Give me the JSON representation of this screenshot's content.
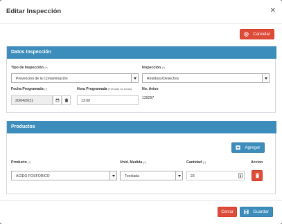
{
  "modal": {
    "title": "Editar Inspección",
    "close_icon": "close-icon"
  },
  "actions": {
    "cancel_top_label": "Cancelar"
  },
  "datos": {
    "header": "Datos Inspección",
    "tipo": {
      "label": "Tipo de Inspección",
      "hint": "(*)",
      "value": "Prevención de la Contaminación"
    },
    "inspeccion": {
      "label": "Inspección",
      "hint": "(*)",
      "value": "Residuos/Desechos"
    },
    "fecha": {
      "label": "Fecha Programada",
      "hint": "(*)",
      "value": "20/04/2021"
    },
    "hora": {
      "label": "Hora Programada",
      "hint": "(Formato 24 horas)",
      "value": "13:00"
    },
    "aviso": {
      "label": "No. Aviso",
      "value": "139297"
    }
  },
  "productos": {
    "header": "Productos",
    "add_label": "Agregar",
    "columns": {
      "producto": {
        "label": "Producto",
        "hint": "(*)"
      },
      "unidad": {
        "label": "Unid. Medida",
        "hint": "(*)"
      },
      "cantidad": {
        "label": "Cantidad",
        "hint": "(*)"
      },
      "accion": {
        "label": "Accion"
      }
    },
    "rows": [
      {
        "producto": "ACIDO FOSFORICO",
        "unidad": "Tonelada",
        "cantidad": "23"
      }
    ]
  },
  "footer": {
    "cerrar_label": "Cerrar",
    "guardar_label": "Guardar"
  },
  "colors": {
    "primary": "#3c8dbc",
    "danger": "#dd4b39"
  }
}
